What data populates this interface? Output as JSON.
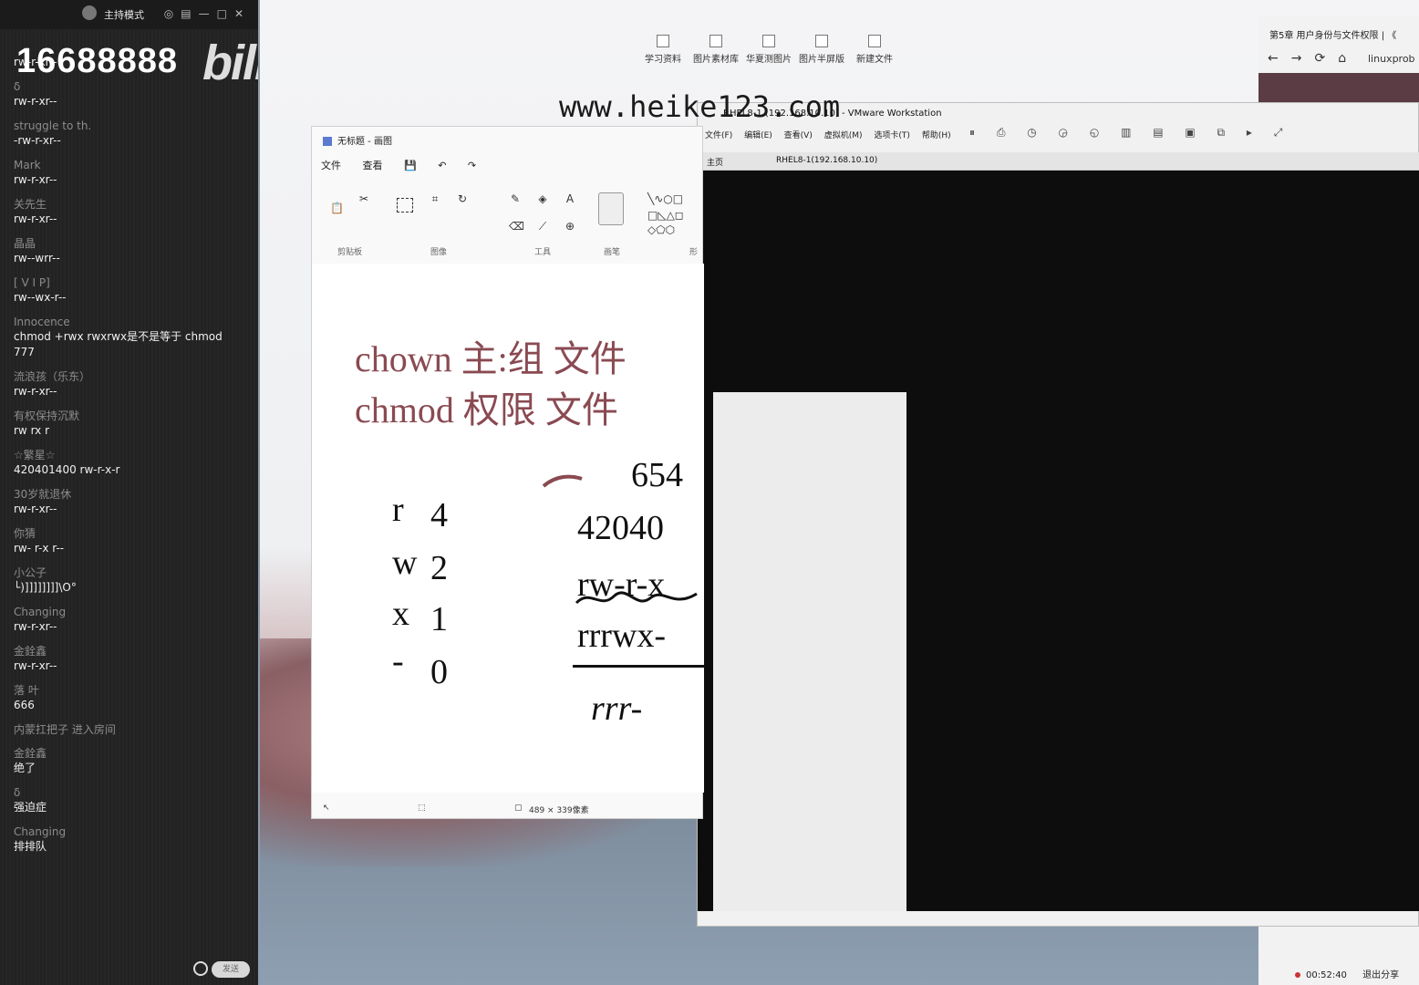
{
  "sidebar": {
    "host_mode": "主持模式",
    "room_number": "16688888",
    "logo_text": "bilibili",
    "messages": [
      {
        "nick": "",
        "text": "rw-r-xr--"
      },
      {
        "nick": "δ",
        "text": "rw-r-xr--"
      },
      {
        "nick": "struggle to th.",
        "text": "-rw-r-xr--"
      },
      {
        "nick": "Mark",
        "text": "rw-r-xr--"
      },
      {
        "nick": "关先生",
        "text": "rw-r-xr--"
      },
      {
        "nick": "晶晶",
        "text": "rw--wrr--"
      },
      {
        "nick": "[ V I P]",
        "text": "rw--wx-r--"
      },
      {
        "nick": "Innocence",
        "text": "chmod +rwx rwxrwx是不是等于 chmod 777"
      },
      {
        "nick": "流浪孩（乐东）",
        "text": "rw-r-xr--"
      },
      {
        "nick": "有权保持沉默",
        "text": "rw rx r"
      },
      {
        "nick": "☆繁星☆",
        "text": "420401400    rw-r-x-r"
      },
      {
        "nick": "30岁就退休",
        "text": "rw-r-xr--"
      },
      {
        "nick": "你猜",
        "text": "rw- r-x r--"
      },
      {
        "nick": "小公子",
        "text": "└)]]]]]]]]\\O°"
      },
      {
        "nick": "Changing",
        "text": "rw-r-xr--"
      },
      {
        "nick": "金銓鑫",
        "text": "rw-r-xr--"
      },
      {
        "nick": "落 叶",
        "text": "666"
      },
      {
        "nick": "内蒙扛把子 进入房间",
        "text": ""
      },
      {
        "nick": "金銓鑫",
        "text": "绝了"
      },
      {
        "nick": "δ",
        "text": "强迫症"
      },
      {
        "nick": "Changing",
        "text": "排排队"
      }
    ],
    "send_label": "发送"
  },
  "watermark": "www.heike123.com",
  "desktop_icons": [
    "学习资料",
    "图片素材库",
    "华夏测图片",
    "图片半屏版",
    "新建文件"
  ],
  "paint": {
    "title": "无标题 - 画图",
    "menu": [
      "文件",
      "查看"
    ],
    "groups": [
      "剪贴板",
      "图像",
      "工具",
      "画笔",
      "形"
    ],
    "canvas": {
      "line1": "chown 主:组 文件",
      "line2": "chmod 权限  文件",
      "symbols": [
        "r",
        "w",
        "x",
        "-"
      ],
      "values": [
        "4",
        "2",
        "1",
        "0"
      ],
      "digits_top": "654",
      "digits_mid": "42040",
      "perm_row1": "rw-r-x",
      "perm_row2": "rrrwx-",
      "perm_row3": "rrr-"
    },
    "status_size": "489 × 339像素"
  },
  "vmware": {
    "title": "RHEL8-1 (192.168.10.10) - VMware Workstation",
    "menu": [
      "文件(F)",
      "编辑(E)",
      "查看(V)",
      "虚拟机(M)",
      "选项卡(T)",
      "帮助(H)"
    ],
    "tab_home": "主页",
    "tab_vm": "RHEL8-1(192.168.10.10)"
  },
  "browser": {
    "tab_title": "第5章 用户身份与文件权限 | 《",
    "url": "linuxprob",
    "timer": "00:52:40",
    "exit_share": "退出分享"
  }
}
